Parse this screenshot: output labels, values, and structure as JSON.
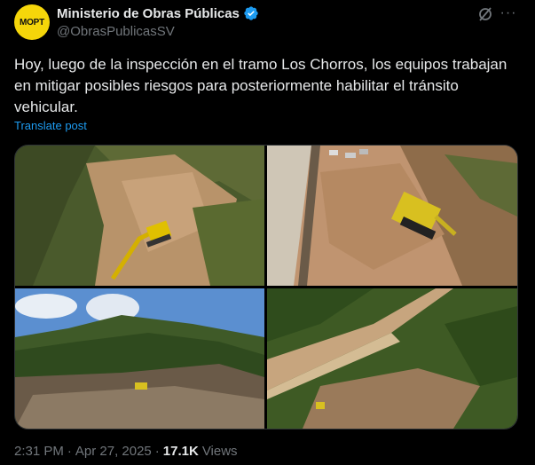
{
  "author": {
    "avatar_text": "MOPT",
    "display_name": "Ministerio de Obras Públicas",
    "handle": "@ObrasPublicasSV",
    "verified_icon": "verified-badge-icon"
  },
  "header_icons": [
    "grok-icon",
    "more-icon"
  ],
  "more_glyph": "···",
  "tweet": {
    "text": "Hoy, luego de la inspección en el tramo Los Chorros, los equipos trabajan en mitigar posibles riesgos para posteriormente habilitar el tránsito vehicular.",
    "translate_label": "Translate post"
  },
  "media": {
    "count": 4,
    "items": [
      "excavator-slope-photo",
      "excavator-aerial-photo",
      "hillside-photo",
      "road-aerial-photo"
    ]
  },
  "meta": {
    "time": "2:31 PM",
    "separator": "·",
    "date": "Apr 27, 2025",
    "views_count": "17.1K",
    "views_label": "Views"
  },
  "colors": {
    "background": "#000000",
    "text": "#e7e9ea",
    "muted": "#71767b",
    "link": "#1d9bf0",
    "avatar": "#f5d60a"
  }
}
